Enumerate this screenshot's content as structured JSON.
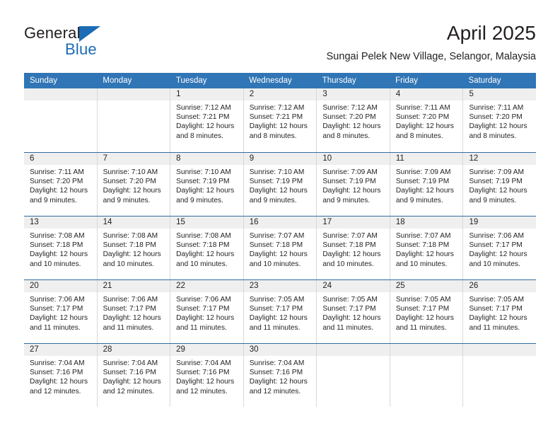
{
  "brand": {
    "name_dark": "General",
    "name_blue": "Blue",
    "triangle_icon": "triangle-icon",
    "accent_color": "#1b6cb5"
  },
  "header": {
    "title": "April 2025",
    "subtitle": "Sungai Pelek New Village, Selangor, Malaysia"
  },
  "colors": {
    "header_row_bg": "#3075b5",
    "day_number_bg": "#efefef",
    "row_divider": "#2e6da4",
    "text": "#231f20"
  },
  "weekdays": [
    "Sunday",
    "Monday",
    "Tuesday",
    "Wednesday",
    "Thursday",
    "Friday",
    "Saturday"
  ],
  "weeks": [
    [
      {
        "day": "",
        "sunrise": "",
        "sunset": "",
        "daylight": "",
        "empty": true
      },
      {
        "day": "",
        "sunrise": "",
        "sunset": "",
        "daylight": "",
        "empty": true
      },
      {
        "day": "1",
        "sunrise": "Sunrise: 7:12 AM",
        "sunset": "Sunset: 7:21 PM",
        "daylight": "Daylight: 12 hours and 8 minutes."
      },
      {
        "day": "2",
        "sunrise": "Sunrise: 7:12 AM",
        "sunset": "Sunset: 7:21 PM",
        "daylight": "Daylight: 12 hours and 8 minutes."
      },
      {
        "day": "3",
        "sunrise": "Sunrise: 7:12 AM",
        "sunset": "Sunset: 7:20 PM",
        "daylight": "Daylight: 12 hours and 8 minutes."
      },
      {
        "day": "4",
        "sunrise": "Sunrise: 7:11 AM",
        "sunset": "Sunset: 7:20 PM",
        "daylight": "Daylight: 12 hours and 8 minutes."
      },
      {
        "day": "5",
        "sunrise": "Sunrise: 7:11 AM",
        "sunset": "Sunset: 7:20 PM",
        "daylight": "Daylight: 12 hours and 8 minutes."
      }
    ],
    [
      {
        "day": "6",
        "sunrise": "Sunrise: 7:11 AM",
        "sunset": "Sunset: 7:20 PM",
        "daylight": "Daylight: 12 hours and 9 minutes."
      },
      {
        "day": "7",
        "sunrise": "Sunrise: 7:10 AM",
        "sunset": "Sunset: 7:20 PM",
        "daylight": "Daylight: 12 hours and 9 minutes."
      },
      {
        "day": "8",
        "sunrise": "Sunrise: 7:10 AM",
        "sunset": "Sunset: 7:19 PM",
        "daylight": "Daylight: 12 hours and 9 minutes."
      },
      {
        "day": "9",
        "sunrise": "Sunrise: 7:10 AM",
        "sunset": "Sunset: 7:19 PM",
        "daylight": "Daylight: 12 hours and 9 minutes."
      },
      {
        "day": "10",
        "sunrise": "Sunrise: 7:09 AM",
        "sunset": "Sunset: 7:19 PM",
        "daylight": "Daylight: 12 hours and 9 minutes."
      },
      {
        "day": "11",
        "sunrise": "Sunrise: 7:09 AM",
        "sunset": "Sunset: 7:19 PM",
        "daylight": "Daylight: 12 hours and 9 minutes."
      },
      {
        "day": "12",
        "sunrise": "Sunrise: 7:09 AM",
        "sunset": "Sunset: 7:19 PM",
        "daylight": "Daylight: 12 hours and 9 minutes."
      }
    ],
    [
      {
        "day": "13",
        "sunrise": "Sunrise: 7:08 AM",
        "sunset": "Sunset: 7:18 PM",
        "daylight": "Daylight: 12 hours and 10 minutes."
      },
      {
        "day": "14",
        "sunrise": "Sunrise: 7:08 AM",
        "sunset": "Sunset: 7:18 PM",
        "daylight": "Daylight: 12 hours and 10 minutes."
      },
      {
        "day": "15",
        "sunrise": "Sunrise: 7:08 AM",
        "sunset": "Sunset: 7:18 PM",
        "daylight": "Daylight: 12 hours and 10 minutes."
      },
      {
        "day": "16",
        "sunrise": "Sunrise: 7:07 AM",
        "sunset": "Sunset: 7:18 PM",
        "daylight": "Daylight: 12 hours and 10 minutes."
      },
      {
        "day": "17",
        "sunrise": "Sunrise: 7:07 AM",
        "sunset": "Sunset: 7:18 PM",
        "daylight": "Daylight: 12 hours and 10 minutes."
      },
      {
        "day": "18",
        "sunrise": "Sunrise: 7:07 AM",
        "sunset": "Sunset: 7:18 PM",
        "daylight": "Daylight: 12 hours and 10 minutes."
      },
      {
        "day": "19",
        "sunrise": "Sunrise: 7:06 AM",
        "sunset": "Sunset: 7:17 PM",
        "daylight": "Daylight: 12 hours and 10 minutes."
      }
    ],
    [
      {
        "day": "20",
        "sunrise": "Sunrise: 7:06 AM",
        "sunset": "Sunset: 7:17 PM",
        "daylight": "Daylight: 12 hours and 11 minutes."
      },
      {
        "day": "21",
        "sunrise": "Sunrise: 7:06 AM",
        "sunset": "Sunset: 7:17 PM",
        "daylight": "Daylight: 12 hours and 11 minutes."
      },
      {
        "day": "22",
        "sunrise": "Sunrise: 7:06 AM",
        "sunset": "Sunset: 7:17 PM",
        "daylight": "Daylight: 12 hours and 11 minutes."
      },
      {
        "day": "23",
        "sunrise": "Sunrise: 7:05 AM",
        "sunset": "Sunset: 7:17 PM",
        "daylight": "Daylight: 12 hours and 11 minutes."
      },
      {
        "day": "24",
        "sunrise": "Sunrise: 7:05 AM",
        "sunset": "Sunset: 7:17 PM",
        "daylight": "Daylight: 12 hours and 11 minutes."
      },
      {
        "day": "25",
        "sunrise": "Sunrise: 7:05 AM",
        "sunset": "Sunset: 7:17 PM",
        "daylight": "Daylight: 12 hours and 11 minutes."
      },
      {
        "day": "26",
        "sunrise": "Sunrise: 7:05 AM",
        "sunset": "Sunset: 7:17 PM",
        "daylight": "Daylight: 12 hours and 11 minutes."
      }
    ],
    [
      {
        "day": "27",
        "sunrise": "Sunrise: 7:04 AM",
        "sunset": "Sunset: 7:16 PM",
        "daylight": "Daylight: 12 hours and 12 minutes."
      },
      {
        "day": "28",
        "sunrise": "Sunrise: 7:04 AM",
        "sunset": "Sunset: 7:16 PM",
        "daylight": "Daylight: 12 hours and 12 minutes."
      },
      {
        "day": "29",
        "sunrise": "Sunrise: 7:04 AM",
        "sunset": "Sunset: 7:16 PM",
        "daylight": "Daylight: 12 hours and 12 minutes."
      },
      {
        "day": "30",
        "sunrise": "Sunrise: 7:04 AM",
        "sunset": "Sunset: 7:16 PM",
        "daylight": "Daylight: 12 hours and 12 minutes."
      },
      {
        "day": "",
        "sunrise": "",
        "sunset": "",
        "daylight": "",
        "empty": true
      },
      {
        "day": "",
        "sunrise": "",
        "sunset": "",
        "daylight": "",
        "empty": true
      },
      {
        "day": "",
        "sunrise": "",
        "sunset": "",
        "daylight": "",
        "empty": true
      }
    ]
  ]
}
